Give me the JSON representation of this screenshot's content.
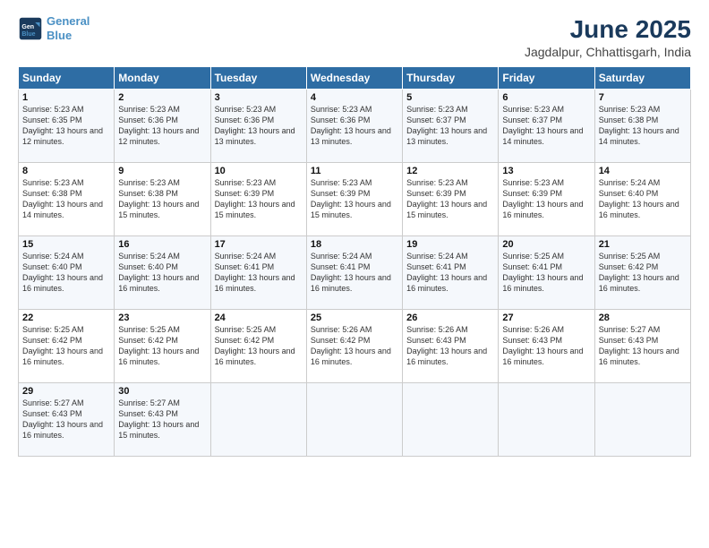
{
  "logo": {
    "line1": "General",
    "line2": "Blue"
  },
  "title": "June 2025",
  "subtitle": "Jagdalpur, Chhattisgarh, India",
  "days_of_week": [
    "Sunday",
    "Monday",
    "Tuesday",
    "Wednesday",
    "Thursday",
    "Friday",
    "Saturday"
  ],
  "weeks": [
    [
      {
        "day": "1",
        "sunrise": "Sunrise: 5:23 AM",
        "sunset": "Sunset: 6:35 PM",
        "daylight": "Daylight: 13 hours and 12 minutes."
      },
      {
        "day": "2",
        "sunrise": "Sunrise: 5:23 AM",
        "sunset": "Sunset: 6:36 PM",
        "daylight": "Daylight: 13 hours and 12 minutes."
      },
      {
        "day": "3",
        "sunrise": "Sunrise: 5:23 AM",
        "sunset": "Sunset: 6:36 PM",
        "daylight": "Daylight: 13 hours and 13 minutes."
      },
      {
        "day": "4",
        "sunrise": "Sunrise: 5:23 AM",
        "sunset": "Sunset: 6:36 PM",
        "daylight": "Daylight: 13 hours and 13 minutes."
      },
      {
        "day": "5",
        "sunrise": "Sunrise: 5:23 AM",
        "sunset": "Sunset: 6:37 PM",
        "daylight": "Daylight: 13 hours and 13 minutes."
      },
      {
        "day": "6",
        "sunrise": "Sunrise: 5:23 AM",
        "sunset": "Sunset: 6:37 PM",
        "daylight": "Daylight: 13 hours and 14 minutes."
      },
      {
        "day": "7",
        "sunrise": "Sunrise: 5:23 AM",
        "sunset": "Sunset: 6:38 PM",
        "daylight": "Daylight: 13 hours and 14 minutes."
      }
    ],
    [
      {
        "day": "8",
        "sunrise": "Sunrise: 5:23 AM",
        "sunset": "Sunset: 6:38 PM",
        "daylight": "Daylight: 13 hours and 14 minutes."
      },
      {
        "day": "9",
        "sunrise": "Sunrise: 5:23 AM",
        "sunset": "Sunset: 6:38 PM",
        "daylight": "Daylight: 13 hours and 15 minutes."
      },
      {
        "day": "10",
        "sunrise": "Sunrise: 5:23 AM",
        "sunset": "Sunset: 6:39 PM",
        "daylight": "Daylight: 13 hours and 15 minutes."
      },
      {
        "day": "11",
        "sunrise": "Sunrise: 5:23 AM",
        "sunset": "Sunset: 6:39 PM",
        "daylight": "Daylight: 13 hours and 15 minutes."
      },
      {
        "day": "12",
        "sunrise": "Sunrise: 5:23 AM",
        "sunset": "Sunset: 6:39 PM",
        "daylight": "Daylight: 13 hours and 15 minutes."
      },
      {
        "day": "13",
        "sunrise": "Sunrise: 5:23 AM",
        "sunset": "Sunset: 6:39 PM",
        "daylight": "Daylight: 13 hours and 16 minutes."
      },
      {
        "day": "14",
        "sunrise": "Sunrise: 5:24 AM",
        "sunset": "Sunset: 6:40 PM",
        "daylight": "Daylight: 13 hours and 16 minutes."
      }
    ],
    [
      {
        "day": "15",
        "sunrise": "Sunrise: 5:24 AM",
        "sunset": "Sunset: 6:40 PM",
        "daylight": "Daylight: 13 hours and 16 minutes."
      },
      {
        "day": "16",
        "sunrise": "Sunrise: 5:24 AM",
        "sunset": "Sunset: 6:40 PM",
        "daylight": "Daylight: 13 hours and 16 minutes."
      },
      {
        "day": "17",
        "sunrise": "Sunrise: 5:24 AM",
        "sunset": "Sunset: 6:41 PM",
        "daylight": "Daylight: 13 hours and 16 minutes."
      },
      {
        "day": "18",
        "sunrise": "Sunrise: 5:24 AM",
        "sunset": "Sunset: 6:41 PM",
        "daylight": "Daylight: 13 hours and 16 minutes."
      },
      {
        "day": "19",
        "sunrise": "Sunrise: 5:24 AM",
        "sunset": "Sunset: 6:41 PM",
        "daylight": "Daylight: 13 hours and 16 minutes."
      },
      {
        "day": "20",
        "sunrise": "Sunrise: 5:25 AM",
        "sunset": "Sunset: 6:41 PM",
        "daylight": "Daylight: 13 hours and 16 minutes."
      },
      {
        "day": "21",
        "sunrise": "Sunrise: 5:25 AM",
        "sunset": "Sunset: 6:42 PM",
        "daylight": "Daylight: 13 hours and 16 minutes."
      }
    ],
    [
      {
        "day": "22",
        "sunrise": "Sunrise: 5:25 AM",
        "sunset": "Sunset: 6:42 PM",
        "daylight": "Daylight: 13 hours and 16 minutes."
      },
      {
        "day": "23",
        "sunrise": "Sunrise: 5:25 AM",
        "sunset": "Sunset: 6:42 PM",
        "daylight": "Daylight: 13 hours and 16 minutes."
      },
      {
        "day": "24",
        "sunrise": "Sunrise: 5:25 AM",
        "sunset": "Sunset: 6:42 PM",
        "daylight": "Daylight: 13 hours and 16 minutes."
      },
      {
        "day": "25",
        "sunrise": "Sunrise: 5:26 AM",
        "sunset": "Sunset: 6:42 PM",
        "daylight": "Daylight: 13 hours and 16 minutes."
      },
      {
        "day": "26",
        "sunrise": "Sunrise: 5:26 AM",
        "sunset": "Sunset: 6:43 PM",
        "daylight": "Daylight: 13 hours and 16 minutes."
      },
      {
        "day": "27",
        "sunrise": "Sunrise: 5:26 AM",
        "sunset": "Sunset: 6:43 PM",
        "daylight": "Daylight: 13 hours and 16 minutes."
      },
      {
        "day": "28",
        "sunrise": "Sunrise: 5:27 AM",
        "sunset": "Sunset: 6:43 PM",
        "daylight": "Daylight: 13 hours and 16 minutes."
      }
    ],
    [
      {
        "day": "29",
        "sunrise": "Sunrise: 5:27 AM",
        "sunset": "Sunset: 6:43 PM",
        "daylight": "Daylight: 13 hours and 16 minutes."
      },
      {
        "day": "30",
        "sunrise": "Sunrise: 5:27 AM",
        "sunset": "Sunset: 6:43 PM",
        "daylight": "Daylight: 13 hours and 15 minutes."
      },
      null,
      null,
      null,
      null,
      null
    ]
  ]
}
